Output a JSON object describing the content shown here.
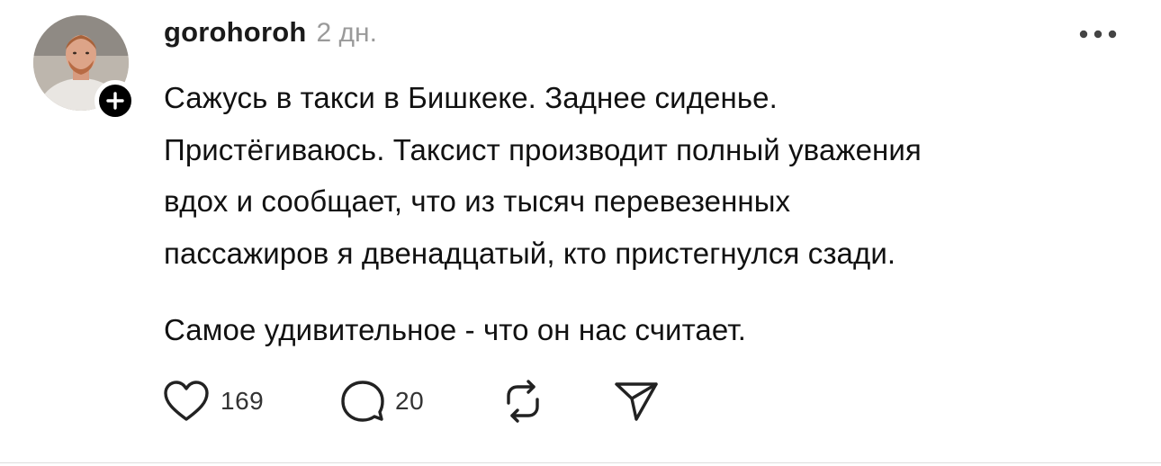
{
  "post": {
    "username": "gorohoroh",
    "time": "2 дн.",
    "paragraphs": [
      "Сажусь в такси в Бишкеке. Заднее сиденье.\nПристёгиваюсь. Таксист производит полный уважения\nвдох и сообщает, что из тысяч перевезенных\nпассажиров я двенадцатый, кто пристегнулся сзади.",
      "Самое удивительное - что он нас считает."
    ],
    "likes": "169",
    "replies": "20"
  },
  "icons": {
    "follow": "plus-icon",
    "more": "more-dots-icon",
    "like": "heart-icon",
    "reply": "comment-bubble-icon",
    "repost": "repost-icon",
    "share": "send-icon"
  }
}
